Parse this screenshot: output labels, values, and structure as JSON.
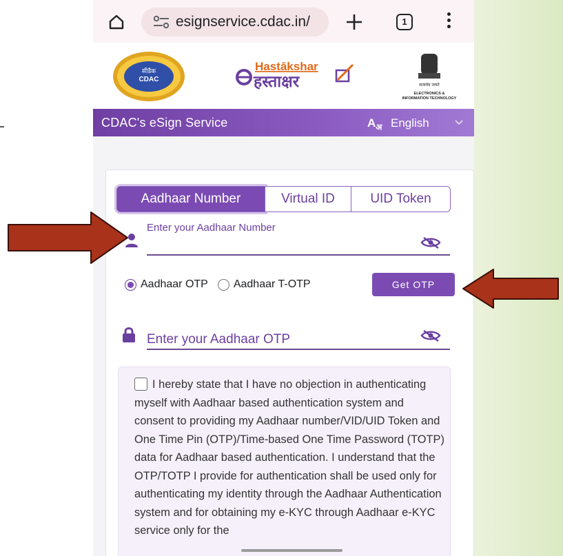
{
  "browser": {
    "url": "esignservice.cdac.in/",
    "tab_count": "1"
  },
  "logos": {
    "cdac_name": "CDAC",
    "cdac_hindi": "सीडैक",
    "hastakshar_en": "Hastākshar",
    "hastakshar_hi": "हस्ताक्षर",
    "ministry_motto": "सत्यमेव जयते",
    "ministry_name": "ELECTRONICS &",
    "ministry_name2": "INFORMATION TECHNOLOGY"
  },
  "service_bar": {
    "title": "CDAC's eSign Service",
    "lang_icon": "A",
    "lang_icon_sub": "अ",
    "language": "English"
  },
  "tabs": [
    {
      "label": "Aadhaar Number",
      "active": true
    },
    {
      "label": "Virtual ID",
      "active": false
    },
    {
      "label": "UID Token",
      "active": false
    }
  ],
  "aadhaar_field": {
    "label": "Enter your Aadhaar Number",
    "value": ""
  },
  "otp_options": [
    {
      "label": "Aadhaar OTP",
      "checked": true
    },
    {
      "label": "Aadhaar T-OTP",
      "checked": false
    }
  ],
  "get_otp_label": "Get OTP",
  "otp_field": {
    "placeholder": "Enter your Aadhaar OTP"
  },
  "consent": {
    "checked": false,
    "text": "I hereby state that I have no objection in authenticating myself with Aadhaar based authentication system and consent to providing my Aadhaar number/VID/UID Token and One Time Pin (OTP)/Time-based One Time Password (TOTP) data for Aadhaar based authentication. I understand that the OTP/TOTP I provide for authentication shall be used only for authenticating my identity through the Aadhaar Authentication system and for obtaining my e-KYC through Aadhaar e-KYC service only for the"
  },
  "colors": {
    "accent": "#7b4bb3",
    "arrow": "#a8321a"
  }
}
